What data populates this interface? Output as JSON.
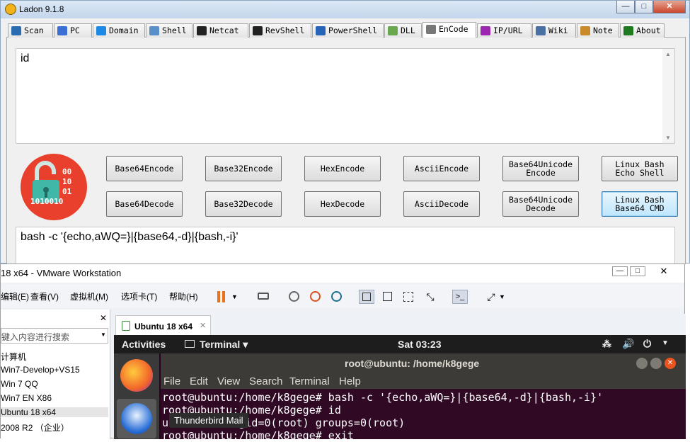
{
  "ladon": {
    "title": "Ladon 9.1.8",
    "window_buttons": {
      "minimize": "—",
      "maximize": "□",
      "close": "✕"
    },
    "tabs": [
      {
        "label": "Scan",
        "icon": "scan-icon",
        "color": "#2b6cb0"
      },
      {
        "label": "PC",
        "icon": "pc-icon",
        "color": "#3b6fd4"
      },
      {
        "label": "Domain",
        "icon": "ie-icon",
        "color": "#1e88e5"
      },
      {
        "label": "Shell",
        "icon": "network-icon",
        "color": "#5a8fc8"
      },
      {
        "label": "Netcat",
        "icon": "cmd-icon",
        "color": "#222222"
      },
      {
        "label": "RevShell",
        "icon": "cmd-icon",
        "color": "#222222"
      },
      {
        "label": "PowerShell",
        "icon": "powershell-icon",
        "color": "#2763b8"
      },
      {
        "label": "DLL",
        "icon": "dll-icon",
        "color": "#6aa84f"
      },
      {
        "label": "EnCode",
        "icon": "encode-icon",
        "color": "#777777"
      },
      {
        "label": "IP/URL",
        "icon": "type-icon",
        "color": "#9b27b0"
      },
      {
        "label": "Wiki",
        "icon": "wiki-icon",
        "color": "#4a6fa5"
      },
      {
        "label": "Note",
        "icon": "note-icon",
        "color": "#c98a2c"
      },
      {
        "label": "About",
        "icon": "about-icon",
        "color": "#1f7a1f"
      }
    ],
    "active_tab": "EnCode",
    "input_text": "id",
    "output_text": "bash -c '{echo,aWQ=}|{base64,-d}|{bash,-i}'",
    "buttons_row1": [
      "Base64Encode",
      "Base32Encode",
      "HexEncode",
      "AsciiEncode",
      "Base64Unicode\nEncode",
      "Linux Bash\nEcho Shell"
    ],
    "buttons_row2": [
      "Base64Decode",
      "Base32Decode",
      "HexDecode",
      "AsciiDecode",
      "Base64Unicode\nDecode",
      "Linux Bash\nBase64 CMD"
    ],
    "logo_text": "00\n10\n01\n1010010",
    "colors": {
      "logo_bg": "#e8402c",
      "lock": "#3fb8a8"
    }
  },
  "vmware": {
    "title": "18 x64 - VMware Workstation",
    "menu": [
      "编辑(E)",
      "查看(V)",
      "虚拟机(M)",
      "选项卡(T)",
      "帮助(H)"
    ],
    "search_placeholder": "键入内容进行搜索",
    "library": [
      "计算机",
      "Win7-Develop+VS15",
      "Win 7 QQ",
      "Win7 EN X86",
      "Ubuntu 18 x64",
      "2008 R2 （企业）"
    ],
    "vm_tab": "Ubuntu 18 x64",
    "tooltip": "Thunderbird Mail"
  },
  "ubuntu": {
    "activities": "Activities",
    "app_menu": "Terminal ▾",
    "clock": "Sat 03:23",
    "terminal_title": "root@ubuntu: /home/k8gege",
    "terminal_menu": [
      "File",
      "Edit",
      "View",
      "Search",
      "Terminal",
      "Help"
    ],
    "lines": [
      "root@ubuntu:/home/k8gege# bash -c '{echo,aWQ=}|{base64,-d}|{bash,-i}'",
      "root@ubuntu:/home/k8gege# id",
      "uid=0(root) gid=0(root) groups=0(root)",
      "root@ubuntu:/home/k8gege# exit"
    ]
  }
}
